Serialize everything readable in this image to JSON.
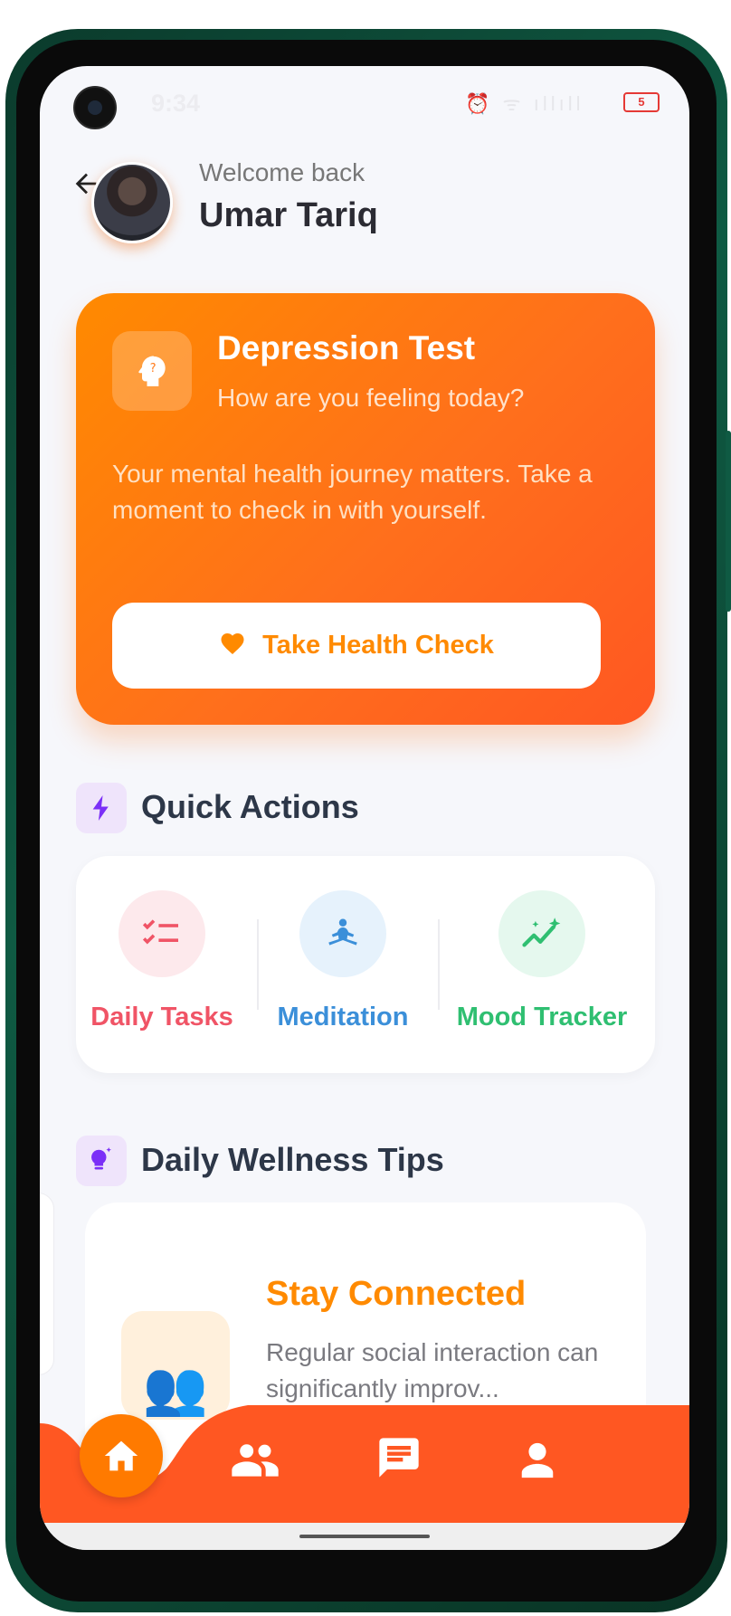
{
  "status_bar": {
    "time": "9:34",
    "icons": "⏰ ᯤ ıllıll",
    "battery": "5"
  },
  "header": {
    "welcome": "Welcome back",
    "username": "Umar Tariq"
  },
  "hero": {
    "title": "Depression Test",
    "subtitle": "How are you feeling today?",
    "description": "Your mental health journey matters. Take a moment to check in with yourself.",
    "button_label": "Take Health Check"
  },
  "quick_actions": {
    "title": "Quick Actions",
    "items": [
      {
        "label": "Daily Tasks",
        "color": "#f05466",
        "bg": "#fde9ec",
        "icon": "checklist-icon"
      },
      {
        "label": "Meditation",
        "color": "#3b8fd9",
        "bg": "#e6f2fc",
        "icon": "meditation-icon"
      },
      {
        "label": "Mood Tracker",
        "color": "#2fbf71",
        "bg": "#e5f8ee",
        "icon": "trend-sparkle-icon"
      }
    ]
  },
  "wellness": {
    "title": "Daily Wellness Tips",
    "card": {
      "title": "Stay Connected",
      "text": "Regular social interaction can significantly improv...",
      "emoji": "👥"
    }
  },
  "nav": {
    "items": [
      "home-icon",
      "community-icon",
      "chat-icon",
      "profile-icon"
    ],
    "active": "home-icon"
  },
  "colors": {
    "accent": "#ff8a00",
    "accent_dark": "#ff5722",
    "nav_bg": "#ff5722"
  }
}
